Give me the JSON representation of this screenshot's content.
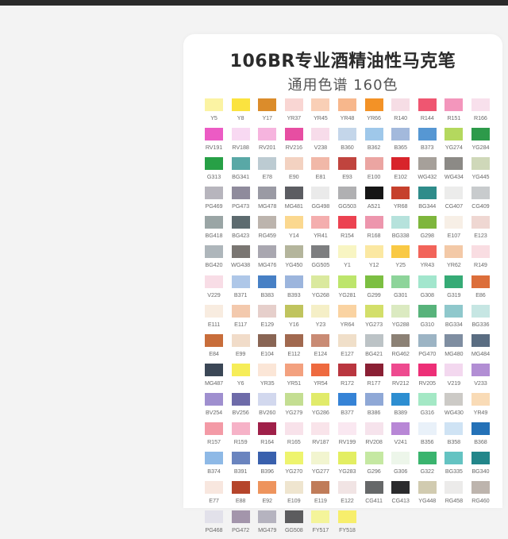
{
  "title": "106BR专业酒精油性马克笔",
  "subtitle": "通用色谱 160色",
  "swatches": [
    {
      "code": "Y5",
      "color": "#fbf3a3"
    },
    {
      "code": "Y8",
      "color": "#fbe33f"
    },
    {
      "code": "Y17",
      "color": "#db8c2b"
    },
    {
      "code": "YR37",
      "color": "#f9d6d3"
    },
    {
      "code": "YR45",
      "color": "#f9cfb6"
    },
    {
      "code": "YR48",
      "color": "#f7b78c"
    },
    {
      "code": "YR66",
      "color": "#f39226"
    },
    {
      "code": "R140",
      "color": "#f6dde5"
    },
    {
      "code": "R144",
      "color": "#ef5671"
    },
    {
      "code": "R151",
      "color": "#f396bc"
    },
    {
      "code": "R166",
      "color": "#f8e0ec"
    },
    {
      "code": "RV191",
      "color": "#ec5bc4"
    },
    {
      "code": "RV188",
      "color": "#f8d9f2"
    },
    {
      "code": "RV201",
      "color": "#f6b4de"
    },
    {
      "code": "RV216",
      "color": "#e74ea2"
    },
    {
      "code": "V238",
      "color": "#f7dcea"
    },
    {
      "code": "B360",
      "color": "#c4d6ea"
    },
    {
      "code": "B362",
      "color": "#9fc8ea"
    },
    {
      "code": "B365",
      "color": "#a3b9dc"
    },
    {
      "code": "B373",
      "color": "#5697d3"
    },
    {
      "code": "YG274",
      "color": "#b4d85e"
    },
    {
      "code": "YG284",
      "color": "#2d9a4a"
    },
    {
      "code": "G313",
      "color": "#27a046"
    },
    {
      "code": "BG341",
      "color": "#59a8a6"
    },
    {
      "code": "E78",
      "color": "#bccbd2"
    },
    {
      "code": "E90",
      "color": "#f3d2c1"
    },
    {
      "code": "E81",
      "color": "#f1b8a8"
    },
    {
      "code": "E93",
      "color": "#c0443e"
    },
    {
      "code": "E100",
      "color": "#eba5a2"
    },
    {
      "code": "E102",
      "color": "#d8242b"
    },
    {
      "code": "WG432",
      "color": "#a6a09a"
    },
    {
      "code": "WG434",
      "color": "#8c8a86"
    },
    {
      "code": "YG445",
      "color": "#cfd8b9"
    },
    {
      "code": "PG469",
      "color": "#b7b5bd"
    },
    {
      "code": "PG473",
      "color": "#8f8b9c"
    },
    {
      "code": "MG478",
      "color": "#9a9aa4"
    },
    {
      "code": "MG481",
      "color": "#5c5d62"
    },
    {
      "code": "GG498",
      "color": "#eaeaea"
    },
    {
      "code": "GG503",
      "color": "#b0b0b2"
    },
    {
      "code": "A521",
      "color": "#161616"
    },
    {
      "code": "YR68",
      "color": "#c6402c"
    },
    {
      "code": "BG344",
      "color": "#2e8c8a"
    },
    {
      "code": "CG407",
      "color": "#ececeb"
    },
    {
      "code": "CG409",
      "color": "#c8cbcd"
    },
    {
      "code": "BG418",
      "color": "#9aa5a5"
    },
    {
      "code": "BG423",
      "color": "#5d6b6f"
    },
    {
      "code": "RG459",
      "color": "#bcb4ad"
    },
    {
      "code": "Y14",
      "color": "#fbd88f"
    },
    {
      "code": "YR41",
      "color": "#f4aeae"
    },
    {
      "code": "R154",
      "color": "#ec4251"
    },
    {
      "code": "R168",
      "color": "#ed96ad"
    },
    {
      "code": "BG338",
      "color": "#b6e2dc"
    },
    {
      "code": "G298",
      "color": "#7eb63c"
    },
    {
      "code": "E107",
      "color": "#f7efe6"
    },
    {
      "code": "E123",
      "color": "#efd7d2"
    },
    {
      "code": "BG420",
      "color": "#aeb6bb"
    },
    {
      "code": "WG438",
      "color": "#7a7672"
    },
    {
      "code": "MG476",
      "color": "#a9a7b0"
    },
    {
      "code": "YG450",
      "color": "#b4b59c"
    },
    {
      "code": "GG505",
      "color": "#7d7e80"
    },
    {
      "code": "Y1",
      "color": "#f8f5c3"
    },
    {
      "code": "Y12",
      "color": "#fbe8a2"
    },
    {
      "code": "Y25",
      "color": "#f9c945"
    },
    {
      "code": "YR43",
      "color": "#f2645a"
    },
    {
      "code": "YR62",
      "color": "#f3c9a7"
    },
    {
      "code": "R149",
      "color": "#f9dde2"
    },
    {
      "code": "V229",
      "color": "#f8dde6"
    },
    {
      "code": "B371",
      "color": "#aec7e8"
    },
    {
      "code": "B383",
      "color": "#4780c5"
    },
    {
      "code": "B393",
      "color": "#9cb5dd"
    },
    {
      "code": "YG268",
      "color": "#dae99e"
    },
    {
      "code": "YG281",
      "color": "#bde56c"
    },
    {
      "code": "G299",
      "color": "#7cbf42"
    },
    {
      "code": "G301",
      "color": "#8dd49a"
    },
    {
      "code": "G308",
      "color": "#a2e6cd"
    },
    {
      "code": "G319",
      "color": "#36ab76"
    },
    {
      "code": "E86",
      "color": "#dc6e3a"
    },
    {
      "code": "E111",
      "color": "#f8ece0"
    },
    {
      "code": "E117",
      "color": "#f3c9ad"
    },
    {
      "code": "E129",
      "color": "#e6cfcb"
    },
    {
      "code": "Y16",
      "color": "#c0c45e"
    },
    {
      "code": "Y23",
      "color": "#f5efc7"
    },
    {
      "code": "YR64",
      "color": "#fad3a2"
    },
    {
      "code": "YG273",
      "color": "#d3df6a"
    },
    {
      "code": "YG288",
      "color": "#dbeac1"
    },
    {
      "code": "G310",
      "color": "#58b37b"
    },
    {
      "code": "BG334",
      "color": "#8fc8cc"
    },
    {
      "code": "BG336",
      "color": "#c6e6e3"
    },
    {
      "code": "E84",
      "color": "#c86d3a"
    },
    {
      "code": "E99",
      "color": "#f1dcc9"
    },
    {
      "code": "E104",
      "color": "#896554"
    },
    {
      "code": "E112",
      "color": "#a1694f"
    },
    {
      "code": "E124",
      "color": "#c98b74"
    },
    {
      "code": "E127",
      "color": "#f0dfc9"
    },
    {
      "code": "BG421",
      "color": "#bcc3c6"
    },
    {
      "code": "RG462",
      "color": "#8c8175"
    },
    {
      "code": "PG470",
      "color": "#9cb4c4"
    },
    {
      "code": "MG480",
      "color": "#7f8ea1"
    },
    {
      "code": "MG484",
      "color": "#5a6d82"
    },
    {
      "code": "MG487",
      "color": "#3b4756"
    },
    {
      "code": "Y6",
      "color": "#f6ed58"
    },
    {
      "code": "YR35",
      "color": "#fbe6d7"
    },
    {
      "code": "YR51",
      "color": "#f3a17f"
    },
    {
      "code": "YR54",
      "color": "#ee6a3f"
    },
    {
      "code": "R172",
      "color": "#b9363f"
    },
    {
      "code": "R177",
      "color": "#8a2034"
    },
    {
      "code": "RV212",
      "color": "#ee4a8f"
    },
    {
      "code": "RV205",
      "color": "#ed2f77"
    },
    {
      "code": "V219",
      "color": "#f3d8ef"
    },
    {
      "code": "V233",
      "color": "#b28ed4"
    },
    {
      "code": "BV254",
      "color": "#9f8fcf"
    },
    {
      "code": "BV256",
      "color": "#6e6ba9"
    },
    {
      "code": "BV260",
      "color": "#d2d8ee"
    },
    {
      "code": "YG279",
      "color": "#c4de92"
    },
    {
      "code": "YG286",
      "color": "#e1eb6a"
    },
    {
      "code": "B377",
      "color": "#3683d6"
    },
    {
      "code": "B386",
      "color": "#8fa8d6"
    },
    {
      "code": "B389",
      "color": "#2d8ed1"
    },
    {
      "code": "G316",
      "color": "#a4e8c5"
    },
    {
      "code": "WG430",
      "color": "#cccac6"
    },
    {
      "code": "YR49",
      "color": "#f9dbb6"
    },
    {
      "code": "R157",
      "color": "#f39aa6"
    },
    {
      "code": "R159",
      "color": "#f6b2c7"
    },
    {
      "code": "R164",
      "color": "#9f2049"
    },
    {
      "code": "R165",
      "color": "#f8e2ea"
    },
    {
      "code": "RV187",
      "color": "#f9e4ea"
    },
    {
      "code": "RV199",
      "color": "#fae8f1"
    },
    {
      "code": "RV208",
      "color": "#f6e3ec"
    },
    {
      "code": "V241",
      "color": "#b887d6"
    },
    {
      "code": "B356",
      "color": "#e9f1f9"
    },
    {
      "code": "B358",
      "color": "#cfe3f4"
    },
    {
      "code": "B368",
      "color": "#2471b7"
    },
    {
      "code": "B374",
      "color": "#8eb9e6"
    },
    {
      "code": "B391",
      "color": "#6a84bf"
    },
    {
      "code": "B396",
      "color": "#3960ad"
    },
    {
      "code": "YG270",
      "color": "#eef46e"
    },
    {
      "code": "YG277",
      "color": "#f2f5d0"
    },
    {
      "code": "YG283",
      "color": "#e3ee62"
    },
    {
      "code": "G296",
      "color": "#c5e8a2"
    },
    {
      "code": "G306",
      "color": "#edf6ea"
    },
    {
      "code": "G322",
      "color": "#3ab46e"
    },
    {
      "code": "BG335",
      "color": "#64c3c2"
    },
    {
      "code": "BG340",
      "color": "#22868a"
    },
    {
      "code": "E77",
      "color": "#f8e7df"
    },
    {
      "code": "E88",
      "color": "#b5452b"
    },
    {
      "code": "E92",
      "color": "#ee945d"
    },
    {
      "code": "E109",
      "color": "#efe5cf"
    },
    {
      "code": "E119",
      "color": "#c07c59"
    },
    {
      "code": "E122",
      "color": "#f1e4e4"
    },
    {
      "code": "CG411",
      "color": "#666869"
    },
    {
      "code": "CG413",
      "color": "#2b2b2d"
    },
    {
      "code": "YG448",
      "color": "#d1cbb0"
    },
    {
      "code": "RG458",
      "color": "#ecebea"
    },
    {
      "code": "RG460",
      "color": "#bdb4ad"
    },
    {
      "code": "PG468",
      "color": "#e2e1ea"
    },
    {
      "code": "PG472",
      "color": "#a395ab"
    },
    {
      "code": "MG479",
      "color": "#b5b3bf"
    },
    {
      "code": "GG508",
      "color": "#5c5c5e"
    },
    {
      "code": "FY517",
      "color": "#f4f49a"
    },
    {
      "code": "FY518",
      "color": "#f7ee6c"
    }
  ]
}
